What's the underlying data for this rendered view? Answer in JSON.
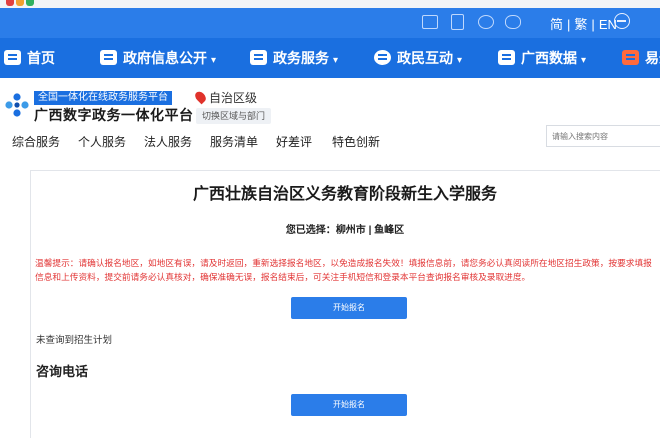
{
  "utility_bar": {
    "icons": [
      "mail-icon",
      "tablet-icon",
      "weibo-icon",
      "wechat-icon"
    ],
    "lang_simplified": "简",
    "sep1": "|",
    "lang_traditional": "繁",
    "sep2": "|",
    "lang_english": "EN",
    "globe_icon": "accessibility-icon"
  },
  "main_nav": {
    "items": [
      {
        "label": "首页",
        "icon": "home-icon"
      },
      {
        "label": "政府信息公开",
        "icon": "document-icon",
        "caret": "▾"
      },
      {
        "label": "政务服务",
        "icon": "service-icon",
        "caret": "▾"
      },
      {
        "label": "政民互动",
        "icon": "chat-icon",
        "caret": "▾"
      },
      {
        "label": "广西数据",
        "icon": "data-icon",
        "caret": "▾"
      },
      {
        "label": "易递",
        "icon": "delivery-icon"
      }
    ]
  },
  "logo": {
    "tagline": "全国一体化在线政务服务平台",
    "title": "广西数字政务一体化平台"
  },
  "region": {
    "label": "自治区级",
    "switch_label": "切换区域与部门"
  },
  "sub_nav": {
    "items": [
      "综合服务",
      "个人服务",
      "法人服务",
      "服务清单",
      "好差评",
      "特色创新"
    ]
  },
  "search": {
    "placeholder": "请输入搜索内容"
  },
  "content": {
    "title": "广西壮族自治区义务教育阶段新生入学服务",
    "selected_prefix": "您已选择：",
    "selected_value": "柳州市 | 鱼峰区",
    "notice": "温馨提示：请确认报名地区，如地区有误，请及时返回，重新选择报名地区，以免造成报名失效！填报信息前，请您务必认真阅读所在地区招生政策，按要求填报信息和上传资料，提交前请务必认真核对，确保准确无误，报名结束后，可关注手机短信和登录本平台查询报名审核及录取进度。",
    "start_button": "开始报名",
    "no_plan": "未查询到招生计划",
    "consult_heading": "咨询电话",
    "start_button_2": "开始报名"
  },
  "colors": {
    "primary": "#1a6fe0",
    "util_bar": "#2b7de9",
    "notice_red": "#e23636"
  }
}
